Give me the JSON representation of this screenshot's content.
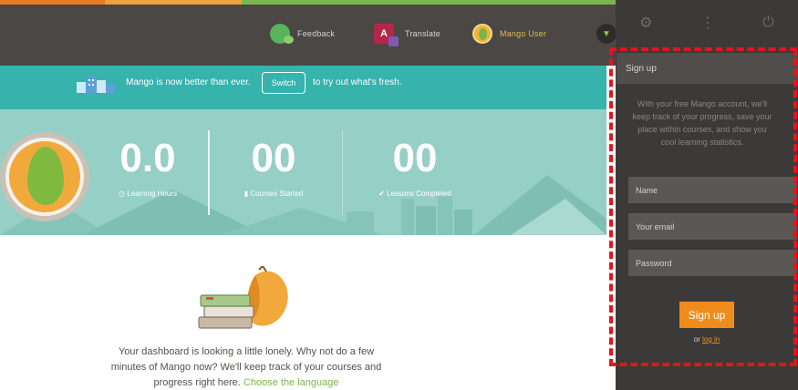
{
  "topbar": {
    "feedback_label": "Feedback",
    "translate_icon_text": "A",
    "translate_label": "Translate",
    "user_label": "Mango User"
  },
  "banner": {
    "text_before": "Mango is now better than ever.",
    "switch_label": "Switch",
    "text_after": "to try out what's fresh."
  },
  "stats": [
    {
      "value": "0.0",
      "caption": "Learning Hours"
    },
    {
      "value": "00",
      "caption": "Courses Started"
    },
    {
      "value": "00",
      "caption": "Lessons Completed"
    }
  ],
  "signup": {
    "heading": "Sign up",
    "description": "With your free Mango account, we'll keep track of your progress, save your place within courses, and show you cool learning statistics.",
    "name_placeholder": "Name",
    "email_placeholder": "Your email",
    "password_placeholder": "Password",
    "button_label": "Sign up",
    "or_text": "or",
    "login_link": "log in"
  },
  "empty_state": {
    "text": "Your dashboard is looking a little lonely. Why not do a few minutes of Mango now? We'll keep track of your courses and progress right here.",
    "link_text": "Choose the language"
  },
  "colors": {
    "teal": "#36b3ad",
    "hero": "#95cfc5",
    "accent_orange": "#f08c1b",
    "mango_green": "#7ab648",
    "dark_panel": "#3c3a38",
    "highlight_red": "#e0161d"
  }
}
